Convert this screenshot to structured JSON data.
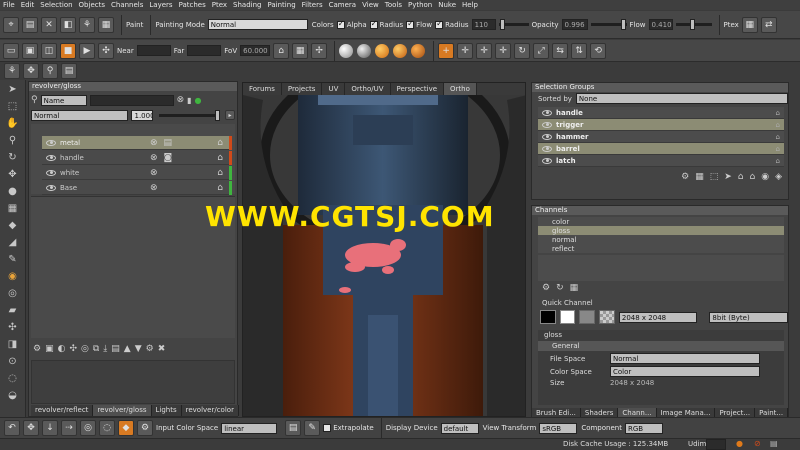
{
  "menu": [
    "File",
    "Edit",
    "Selection",
    "Objects",
    "Channels",
    "Layers",
    "Patches",
    "Ptex",
    "Shading",
    "Painting",
    "Filters",
    "Camera",
    "View",
    "Tools",
    "Python",
    "Nuke",
    "Help"
  ],
  "paint_toolbar": {
    "paint_label": "Paint",
    "mode_label": "Painting Mode",
    "mode_value": "Normal",
    "colors_label": "Colors",
    "alpha_label": "Alpha",
    "radius_chk_label": "Radius",
    "flow_chk_label": "Flow",
    "radius_label": "Radius",
    "radius_value": "110",
    "opacity_label": "Opacity",
    "opacity_value": "0.996",
    "flow_label": "Flow",
    "flow_value": "0.410",
    "ptex_label": "Ptex"
  },
  "camera_toolbar": {
    "near_label": "Near",
    "far_label": "Far",
    "fov_label": "FoV",
    "fov_value": "60.000"
  },
  "layers_panel": {
    "title": "revolver/gloss",
    "filter_select": "Name",
    "blend_mode": "Normal",
    "opacity_value": "1.000",
    "layers": [
      {
        "name": "metal",
        "bar": "#d04a1a"
      },
      {
        "name": "handle",
        "bar": "#d04a1a"
      },
      {
        "name": "white",
        "bar": "#3fb53f"
      },
      {
        "name": "Base",
        "bar": "#3fb53f"
      }
    ],
    "tabs": [
      "revolver/reflect",
      "revolver/gloss",
      "Lights",
      "revolver/color"
    ]
  },
  "viewport": {
    "tabs": [
      "Forums",
      "Projects",
      "UV",
      "Ortho/UV",
      "Perspective",
      "Ortho"
    ]
  },
  "selection_groups": {
    "title": "Selection Groups",
    "sorted_by_label": "Sorted by",
    "sorted_by_value": "None",
    "groups": [
      "handle",
      "trigger",
      "hammer",
      "barrel",
      "latch"
    ]
  },
  "channels": {
    "title": "Channels",
    "items": [
      "color",
      "gloss",
      "normal",
      "reflect"
    ],
    "quick_channel_label": "Quick Channel",
    "size_value": "2048 x 2048",
    "depth_value": "8bit  (Byte)",
    "props_title": "gloss",
    "general_label": "General",
    "file_space_label": "File Space",
    "file_space_value": "Normal",
    "color_space_label": "Color Space",
    "color_space_value": "Color",
    "size_label": "Size",
    "size_prop_value": "2048 x 2048",
    "tabs": [
      "Brush Edi...",
      "Shaders",
      "Chann...",
      "Image Mana...",
      "Project...",
      "Paint..."
    ]
  },
  "bottom_toolbar": {
    "input_cs_label": "Input Color Space",
    "input_cs_value": "linear",
    "extrapolate_label": "Extrapolate",
    "display_device_label": "Display Device",
    "display_device_value": "default",
    "view_transform_label": "View Transform",
    "view_transform_value": "sRGB",
    "component_label": "Component",
    "component_value": "RGB"
  },
  "status": {
    "disk_cache": "Disk Cache Usage : 125.34MB",
    "udim_label": "Udim:"
  },
  "watermark": "WWW.CGTSJ.COM",
  "colors": {
    "selected_row": "#8c8c74",
    "accent_orange": "#e07a1a",
    "watermark": "#ffe400"
  }
}
